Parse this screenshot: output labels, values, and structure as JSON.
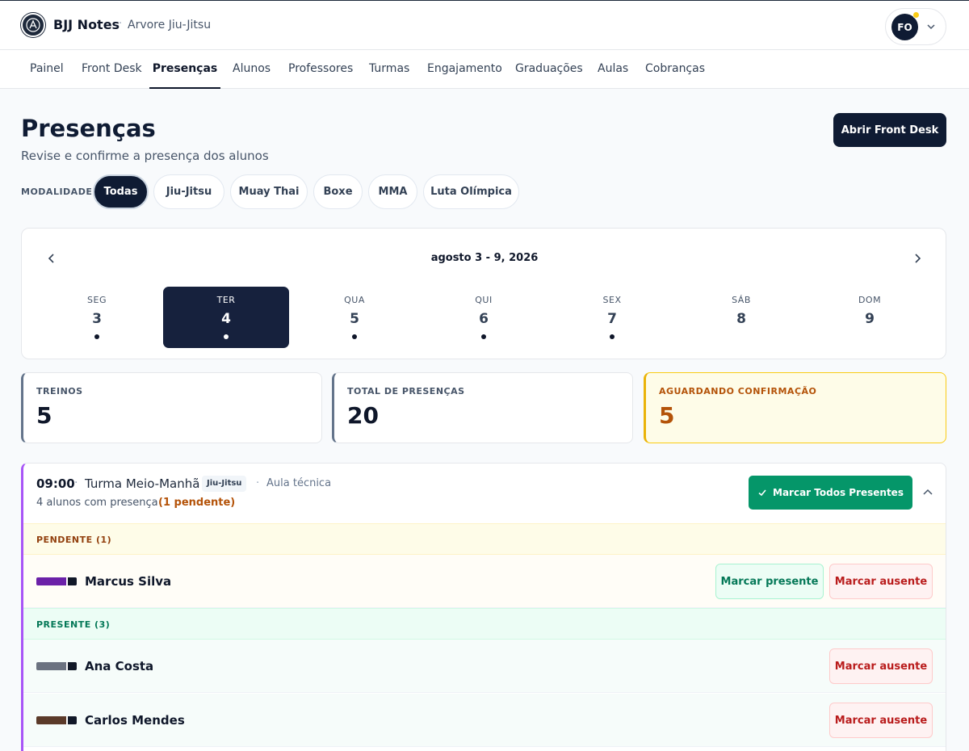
{
  "header": {
    "app_name": "BJJ Notes",
    "separator": "·",
    "academy": "Arvore Jiu-Jitsu",
    "user_initials": "FO",
    "logo_icon": "bjj-logo-icon",
    "notification_color": "#facc15"
  },
  "nav": {
    "items": [
      {
        "label": "Painel",
        "active": false
      },
      {
        "label": "Front Desk",
        "active": false
      },
      {
        "label": "Presenças",
        "active": true
      },
      {
        "label": "Alunos",
        "active": false
      },
      {
        "label": "Professores",
        "active": false
      },
      {
        "label": "Turmas",
        "active": false
      },
      {
        "label": "Engajamento",
        "active": false
      },
      {
        "label": "Graduações",
        "active": false
      },
      {
        "label": "Aulas",
        "active": false
      },
      {
        "label": "Cobranças",
        "active": false
      }
    ]
  },
  "page": {
    "title": "Presenças",
    "subtitle": "Revise e confirme a presença dos alunos",
    "primary_button": "Abrir Front Desk"
  },
  "filters": {
    "label": "MODALIDADE",
    "options": [
      "Todas",
      "Jiu-Jitsu",
      "Muay Thai",
      "Boxe",
      "MMA",
      "Luta Olímpica"
    ],
    "selected": "Todas"
  },
  "week": {
    "range": "agosto 3 - 9, 2026",
    "days": [
      {
        "name": "SEG",
        "num": "3",
        "has_sessions": true,
        "selected": false
      },
      {
        "name": "TER",
        "num": "4",
        "has_sessions": true,
        "selected": true
      },
      {
        "name": "QUA",
        "num": "5",
        "has_sessions": true,
        "selected": false
      },
      {
        "name": "QUI",
        "num": "6",
        "has_sessions": true,
        "selected": false
      },
      {
        "name": "SEX",
        "num": "7",
        "has_sessions": true,
        "selected": false
      },
      {
        "name": "SÁB",
        "num": "8",
        "has_sessions": false,
        "selected": false
      },
      {
        "name": "DOM",
        "num": "9",
        "has_sessions": false,
        "selected": false
      }
    ]
  },
  "stats": {
    "treinos": {
      "label": "TREINOS",
      "value": "5"
    },
    "total": {
      "label": "TOTAL DE PRESENÇAS",
      "value": "20"
    },
    "pending": {
      "label": "AGUARDANDO CONFIRMAÇÃO",
      "value": "5"
    }
  },
  "session": {
    "time": "09:00",
    "separator": "·",
    "class_name": "Turma Meio-Manhã",
    "modality": "Jiu-Jitsu",
    "type": "Aula técnica",
    "count_text": "4 alunos com presença",
    "pending_text": "(1 pendente)",
    "mark_all_button": "Marcar Todos Presentes",
    "accent_color": "#a855f7",
    "pending_group": {
      "label": "PENDENTE (1)",
      "students": [
        {
          "name": "Marcus Silva",
          "belt_color": "#6b21a8"
        }
      ]
    },
    "present_group": {
      "label": "PRESENTE (3)",
      "students": [
        {
          "name": "Ana Costa",
          "belt_color": "#6b7280"
        },
        {
          "name": "Carlos Mendes",
          "belt_color": "#5b3a29"
        }
      ]
    },
    "mark_present_label": "Marcar presente",
    "mark_absent_label": "Marcar ausente"
  }
}
